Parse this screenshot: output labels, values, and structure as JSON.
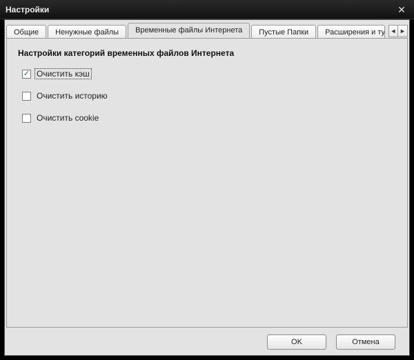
{
  "window": {
    "title": "Настройки"
  },
  "tabs": {
    "general": "Общие",
    "junk": "Ненужные файлы",
    "temp_internet": "Временные файлы Интернета",
    "empty_folders": "Пустые Папки",
    "extensions": "Расширения и ту",
    "scroll_left": "◄",
    "scroll_right": "►"
  },
  "panel": {
    "heading": "Настройки категорий временных файлов Интернета",
    "options": {
      "clear_cache": {
        "label": "Очистить кэш",
        "checked": true,
        "focused": true
      },
      "clear_history": {
        "label": "Очистить историю",
        "checked": false,
        "focused": false
      },
      "clear_cookie": {
        "label": "Очистить cookie",
        "checked": false,
        "focused": false
      }
    }
  },
  "buttons": {
    "ok": "OK",
    "cancel": "Отмена"
  },
  "glyphs": {
    "check": "✓",
    "close": "✕"
  }
}
